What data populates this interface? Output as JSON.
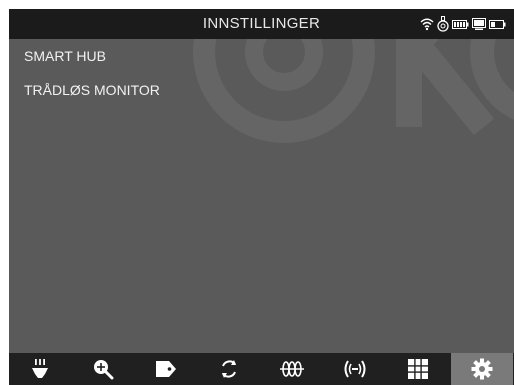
{
  "header": {
    "title": "INNSTILLINGER",
    "status_icons": [
      "wifi-icon",
      "handset-icon",
      "battery-icon",
      "monitor-icon",
      "monitor-battery-icon"
    ]
  },
  "menu": {
    "items": [
      {
        "label": "SMART HUB",
        "icon": ""
      },
      {
        "label": "TRÅDLØS MONITOR",
        "icon": ""
      }
    ]
  },
  "toolbar": {
    "items": [
      {
        "icon": "light-icon",
        "active": false
      },
      {
        "icon": "zoom-icon",
        "active": false
      },
      {
        "icon": "tag-icon",
        "active": false
      },
      {
        "icon": "rotate-icon",
        "active": false
      },
      {
        "icon": "temperature-icon",
        "active": false
      },
      {
        "icon": "sound-icon",
        "active": false
      },
      {
        "icon": "grid-icon",
        "active": false
      },
      {
        "icon": "settings-icon",
        "active": true
      }
    ]
  },
  "colors": {
    "header_bg": "#1b1b1b",
    "content_bg": "#5a5a5a",
    "toolbar_bg": "#202020",
    "active_tab_bg": "#7a7a7a",
    "text": "#f2f2f2"
  }
}
